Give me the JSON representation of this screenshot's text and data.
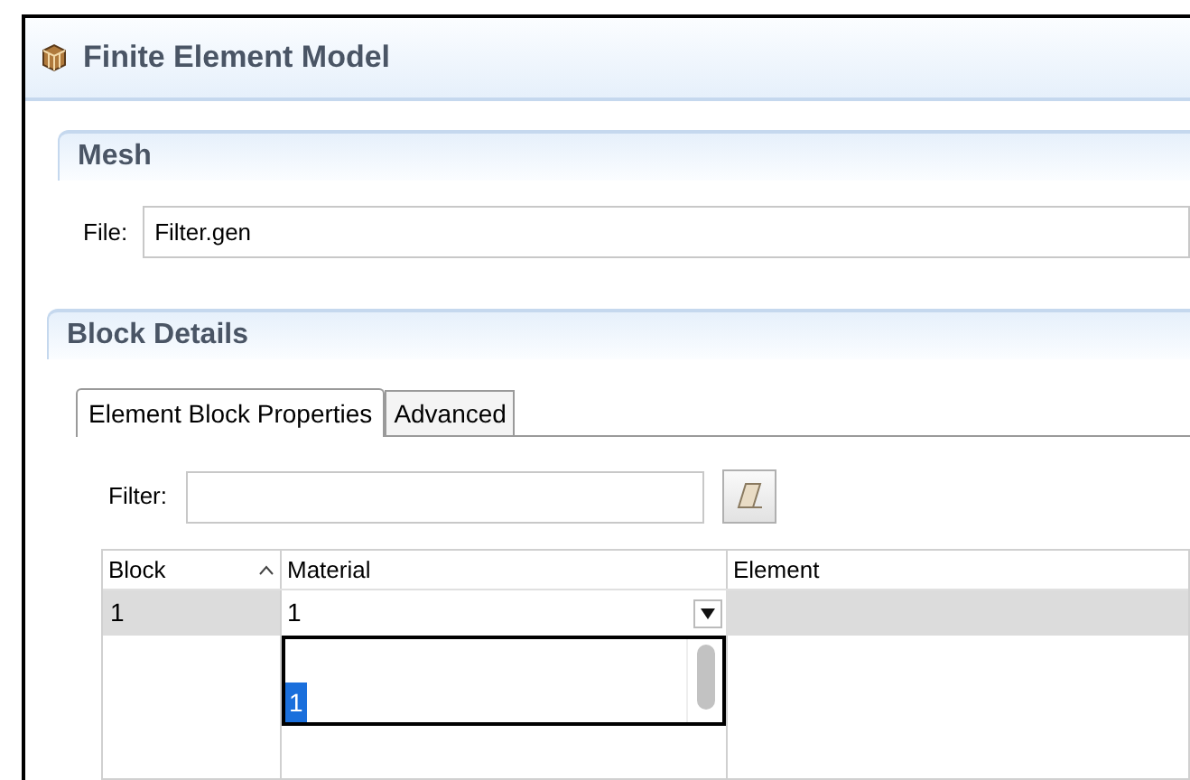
{
  "title": "Finite Element Model",
  "mesh": {
    "heading": "Mesh",
    "file_label": "File:",
    "file_value": "Filter.gen"
  },
  "block_details": {
    "heading": "Block Details",
    "tabs": [
      {
        "label": "Element Block Properties",
        "selected": true
      },
      {
        "label": "Advanced",
        "selected": false
      }
    ],
    "filter": {
      "label": "Filter:"
    },
    "table": {
      "columns": [
        {
          "label": "Block",
          "sorted": true
        },
        {
          "label": "Material",
          "sorted": false
        },
        {
          "label": "Element",
          "sorted": false
        }
      ],
      "rows": [
        {
          "block": "1",
          "material": "1",
          "selected": true
        }
      ]
    },
    "dropdown": {
      "options": [
        {
          "label": "1",
          "selected": true
        }
      ]
    }
  }
}
